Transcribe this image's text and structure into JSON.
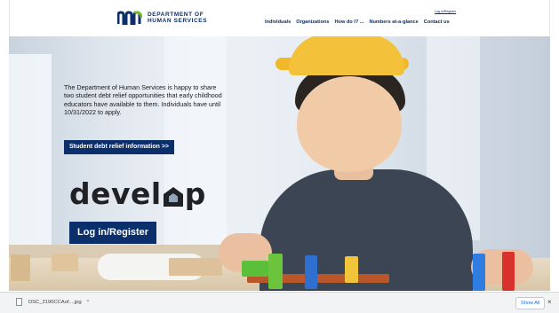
{
  "header": {
    "logo_text_line1": "DEPARTMENT OF",
    "logo_text_line2": "HUMAN SERVICES",
    "login_link": "Log in/Register",
    "nav": [
      "Individuals",
      "Organizations",
      "How do I? ...",
      "Numbers at-a-glance",
      "Contact us"
    ]
  },
  "hero": {
    "announcement": "The Department of Human Services is happy to share two student debt relief opportunities that early childhood educators have available to them. Individuals have until 10/31/2022 to apply.",
    "debt_button": "Student debt relief information >>",
    "develop_left": "devel",
    "develop_right": "p",
    "login_button": "Log in/Register"
  },
  "downloads": {
    "file_name": "DSC_2190CCAof....jpg",
    "chevron": "^",
    "show_all": "Show All",
    "close": "×"
  },
  "colors": {
    "brand_navy": "#0b2f6b",
    "brand_green": "#78be20",
    "hat_yellow": "#f3c23a"
  }
}
